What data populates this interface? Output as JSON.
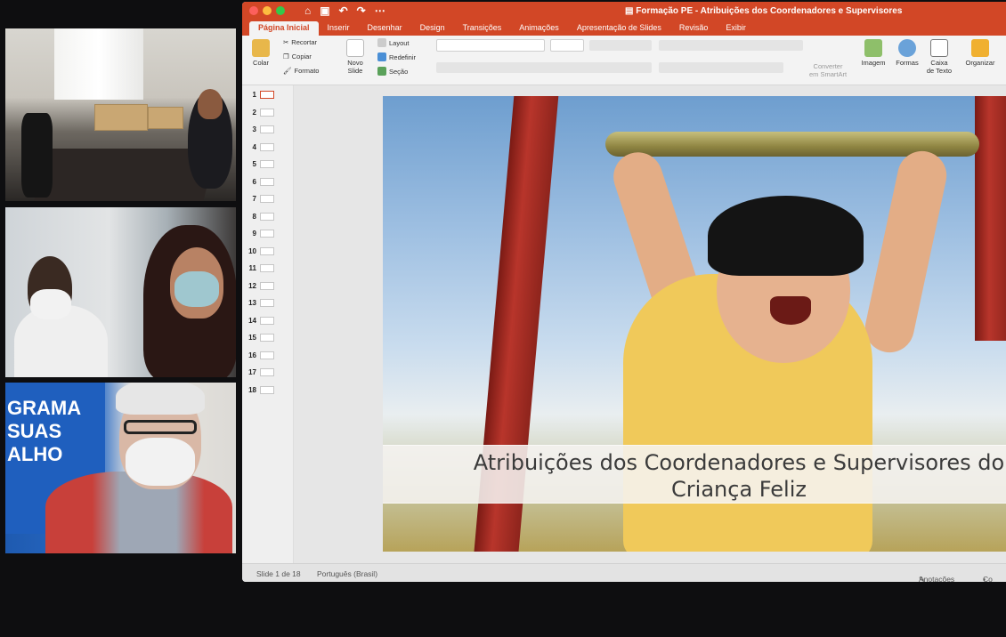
{
  "window": {
    "doc_title": "Formação PE - Atribuições dos Coordenadores e Supervisores",
    "doc_icon": "powerpoint-doc-icon",
    "accent": "#d24726"
  },
  "ribbon_tabs": [
    {
      "label": "Página Inicial",
      "active": true
    },
    {
      "label": "Inserir"
    },
    {
      "label": "Desenhar"
    },
    {
      "label": "Design"
    },
    {
      "label": "Transições"
    },
    {
      "label": "Animações"
    },
    {
      "label": "Apresentação de Slides"
    },
    {
      "label": "Revisão"
    },
    {
      "label": "Exibir"
    }
  ],
  "ribbon": {
    "paste": "Colar",
    "cut": "Recortar",
    "copy": "Copiar",
    "format": "Formato",
    "new_slide_line1": "Novo",
    "new_slide_line2": "Slide",
    "layout": "Layout",
    "reset": "Redefinir",
    "section": "Seção",
    "convert_line1": "Converter",
    "convert_line2": "em SmartArt",
    "image": "Imagem",
    "shapes": "Formas",
    "textbox_line1": "Caixa",
    "textbox_line2": "de Texto",
    "arrange": "Organizar"
  },
  "slides": [
    "1",
    "2",
    "3",
    "4",
    "5",
    "6",
    "7",
    "8",
    "9",
    "10",
    "11",
    "12",
    "13",
    "14",
    "15",
    "16",
    "17",
    "18"
  ],
  "selected_slide": "1",
  "slide": {
    "title_line1": "Atribuições dos Coordenadores e Supervisores do",
    "title_line2": "Criança Feliz"
  },
  "statusbar": {
    "slide_count": "Slide 1 de 18",
    "language": "Português (Brasil)",
    "notes": "Anotações",
    "comments": "Co"
  },
  "video": {
    "banner_text": [
      "GRAMA",
      "SUAS",
      "ALHO"
    ]
  }
}
